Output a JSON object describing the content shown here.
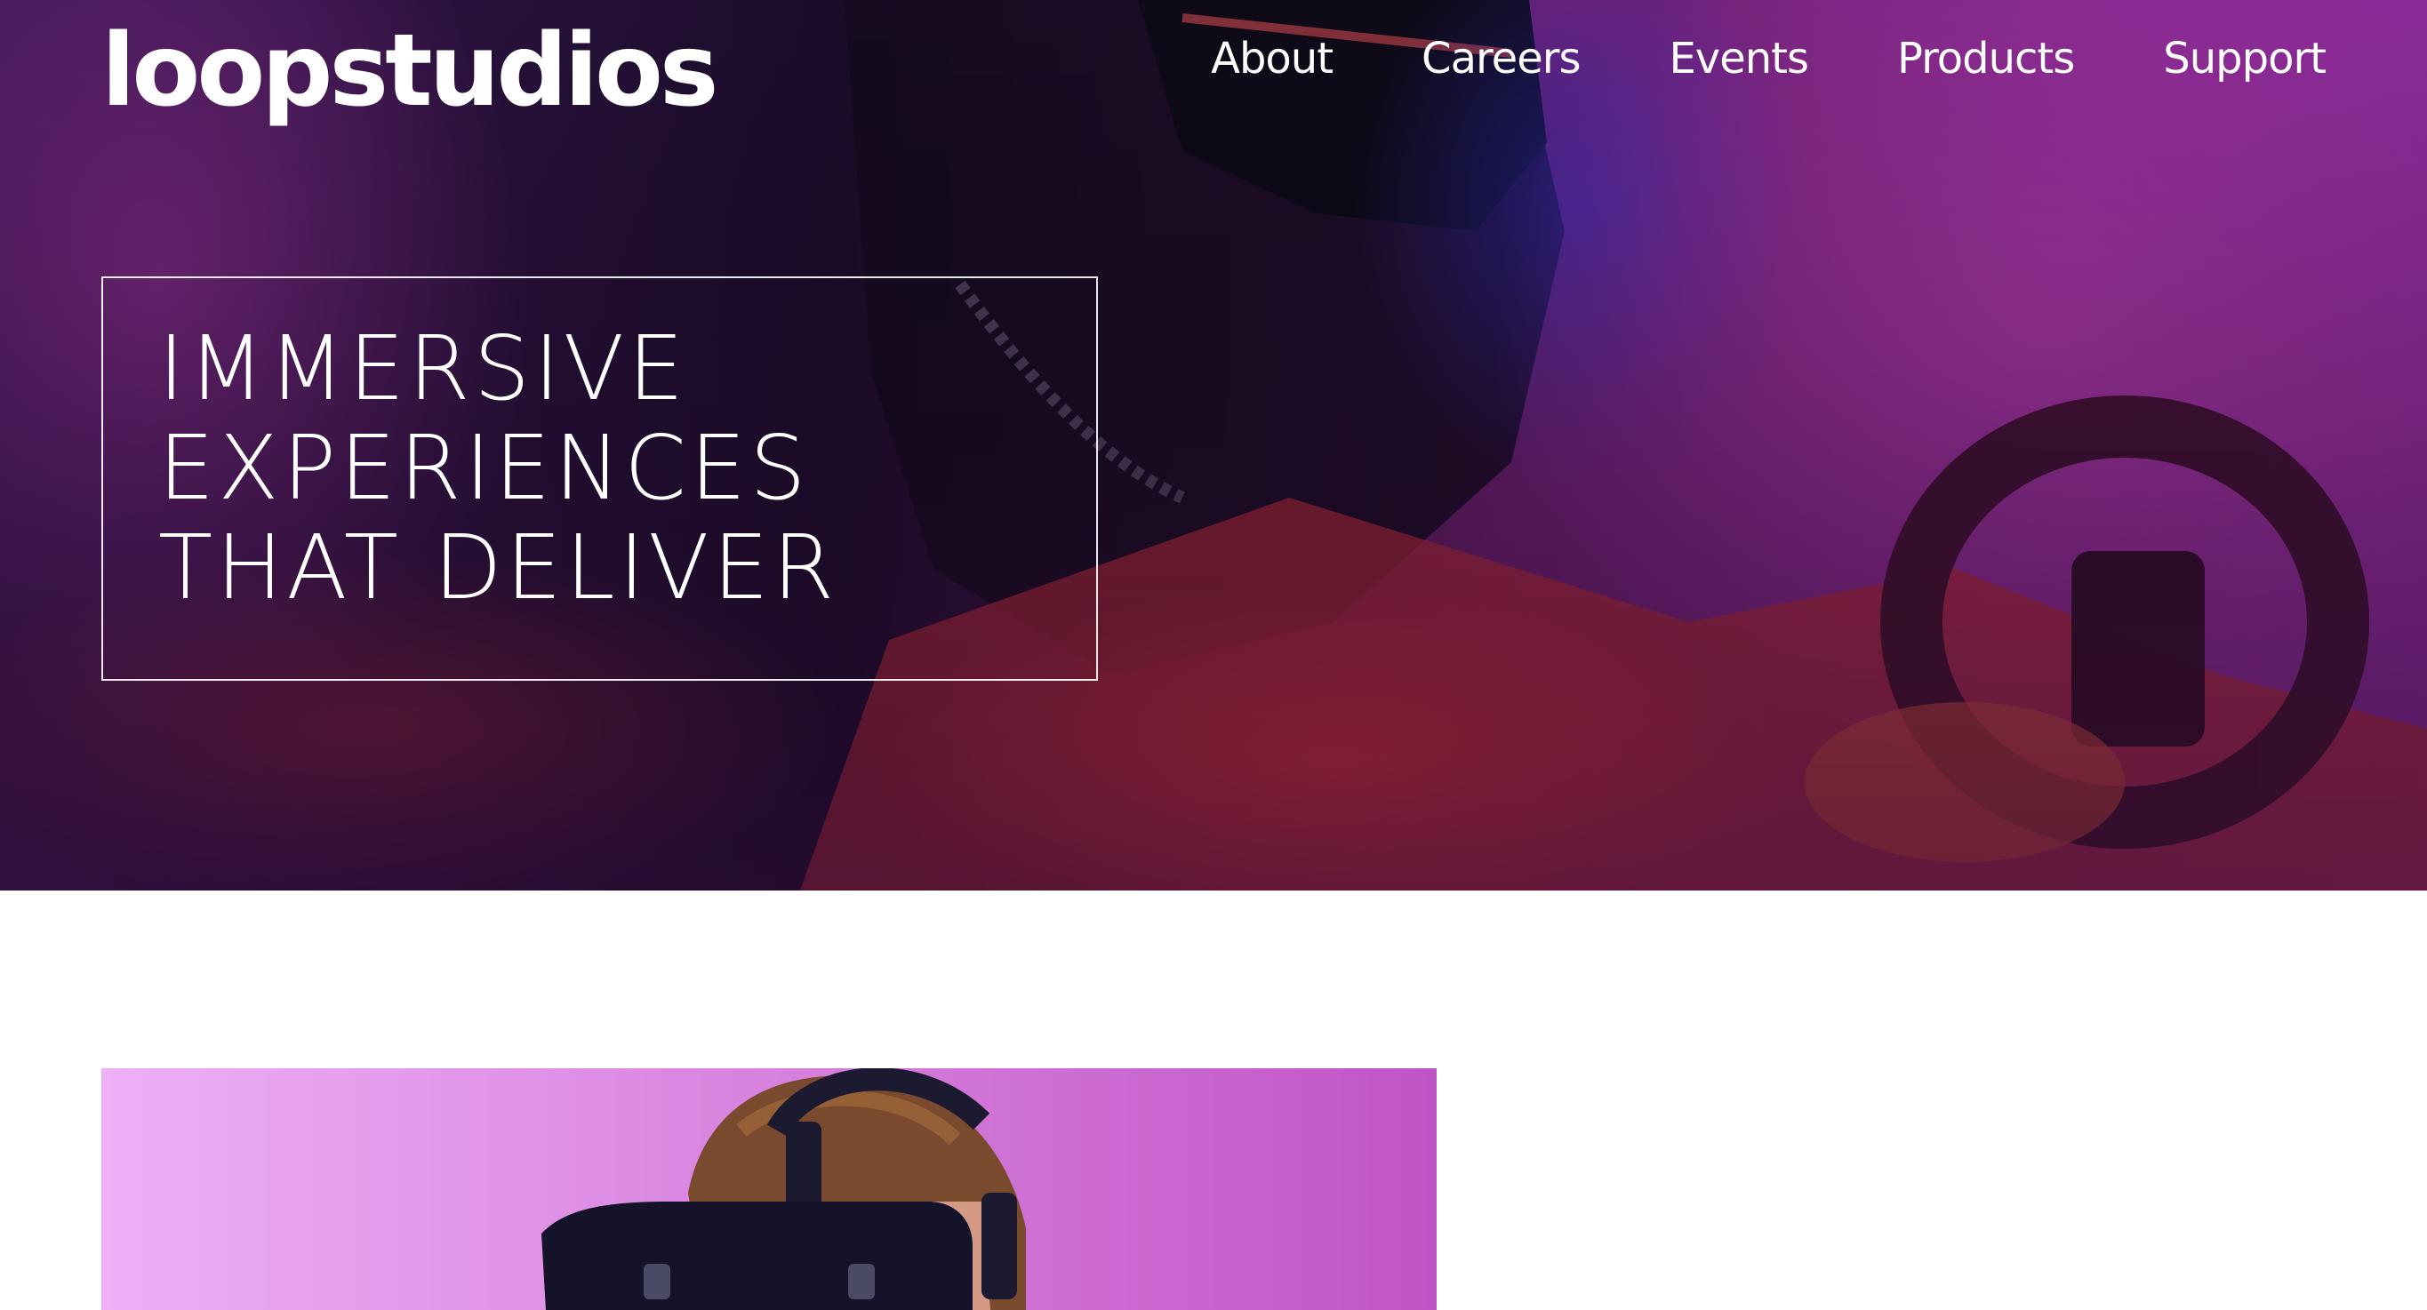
{
  "header": {
    "logo_text": "loopstudios",
    "nav": [
      {
        "label": "About"
      },
      {
        "label": "Careers"
      },
      {
        "label": "Events"
      },
      {
        "label": "Products"
      },
      {
        "label": "Support"
      }
    ]
  },
  "hero": {
    "title_lines": [
      "IMMERSIVE",
      "EXPERIENCES",
      "THAT DELIVER"
    ],
    "image_subject": "person wearing VR headset with steering wheel, magenta and red tinted",
    "colors": {
      "deep": "#1a0b2e",
      "purple": "#7b2a8c",
      "magenta": "#b03a9a",
      "red": "#c8322f",
      "blue": "#3a2fb0"
    }
  },
  "feature": {
    "image_subject": "man wearing VR headset on pink-purple background",
    "colors": {
      "bg_light": "#eaa6f2",
      "bg_dark": "#c159c7",
      "headset": "#14132a",
      "hair": "#7a4a2e"
    }
  }
}
